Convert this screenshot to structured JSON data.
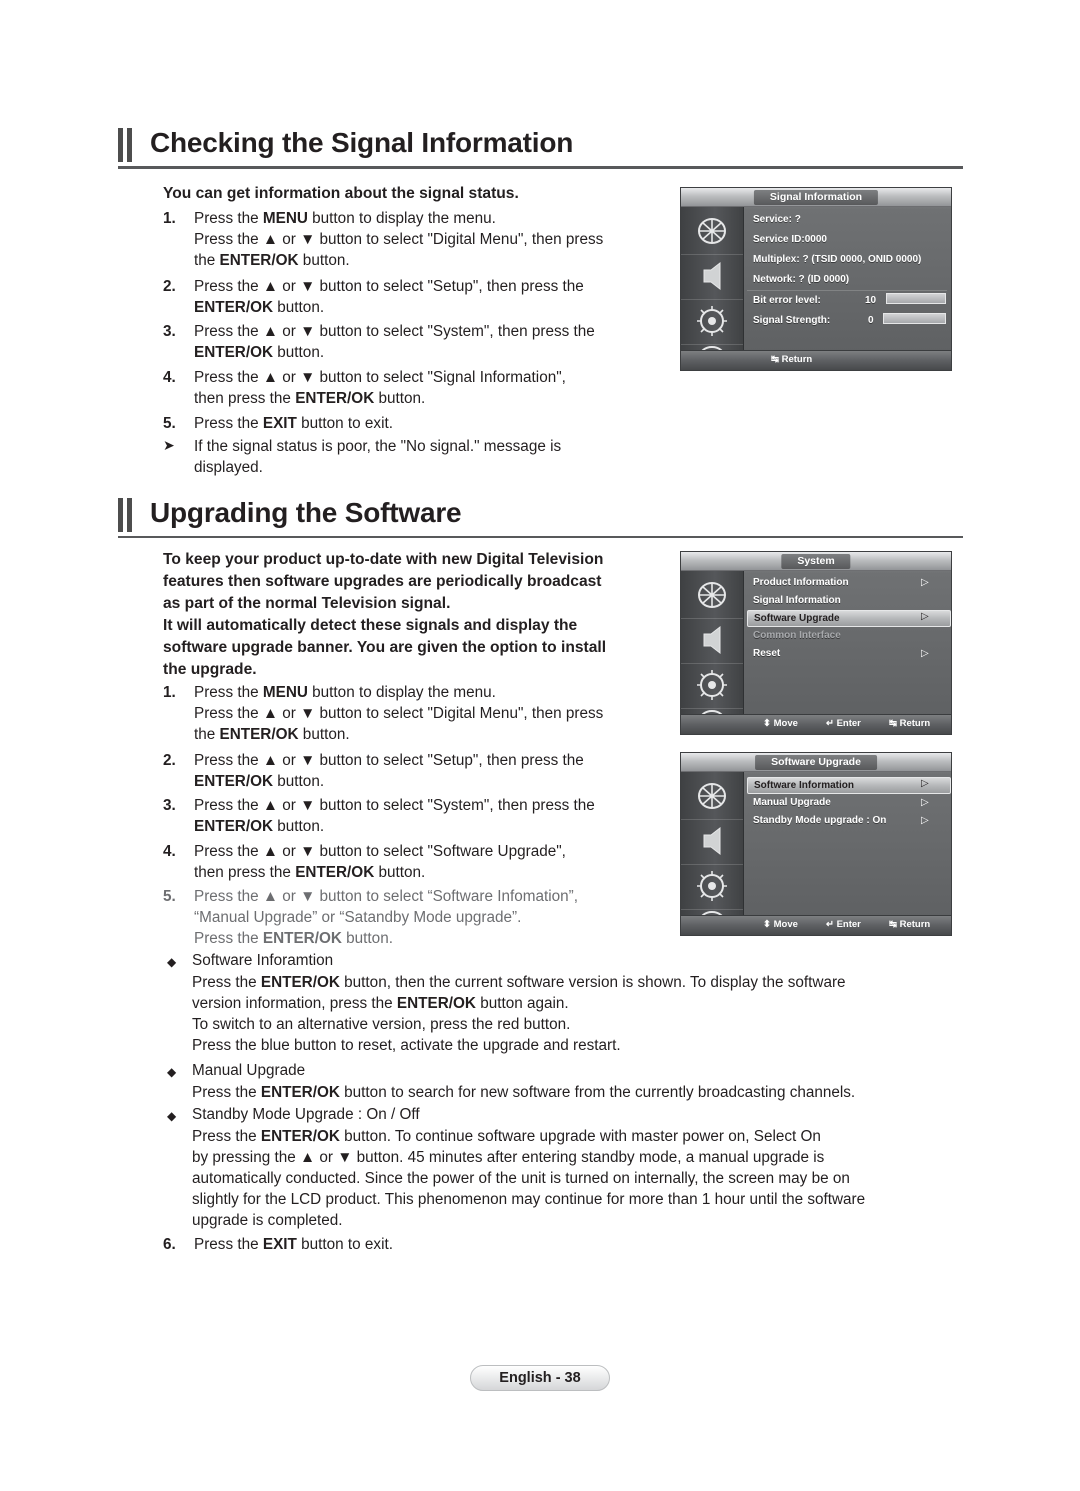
{
  "sections": {
    "signal": {
      "title": "Checking the Signal Information",
      "intro": "You can get information about the signal status.",
      "steps": [
        {
          "n": "1.",
          "lines": [
            "Press the MENU button to display the menu.",
            "Press the ▲ or ▼ button to select \"Digital Menu\", then press",
            "the ENTER/OK button."
          ]
        },
        {
          "n": "2.",
          "lines": [
            "Press the ▲ or ▼ button to select \"Setup\", then press the",
            "ENTER/OK button."
          ]
        },
        {
          "n": "3.",
          "lines": [
            "Press the ▲ or ▼ button to select \"System\", then press the",
            "ENTER/OK button."
          ]
        },
        {
          "n": "4.",
          "lines": [
            "Press the ▲ or ▼ button to select \"Signal Information\",",
            "then press the ENTER/OK button."
          ]
        },
        {
          "n": "5.",
          "lines": [
            "Press the EXIT button to exit."
          ]
        }
      ],
      "note": [
        "If the signal status is poor, the \"No signal.\" message is",
        "displayed."
      ]
    },
    "upgrade": {
      "title": "Upgrading the Software",
      "intro": [
        "To keep your product up-to-date with new Digital Television",
        "features then software upgrades are periodically broadcast",
        "as part of the normal Television signal.",
        "It will automatically detect these signals and display the",
        "software upgrade banner. You are given the option to install",
        "the upgrade."
      ],
      "steps": [
        {
          "n": "1.",
          "lines": [
            "Press the MENU button to display the menu.",
            "Press the ▲ or ▼ button to select \"Digital Menu\", then press",
            "the ENTER/OK button."
          ]
        },
        {
          "n": "2.",
          "lines": [
            "Press the ▲ or ▼ button to select \"Setup\", then press the",
            "ENTER/OK button."
          ]
        },
        {
          "n": "3.",
          "lines": [
            "Press the ▲ or ▼ button to select \"System\", then press the",
            "ENTER/OK button."
          ]
        },
        {
          "n": "4.",
          "lines": [
            "Press the ▲ or ▼ button to select \"Software Upgrade\",",
            "then press the ENTER/OK button."
          ]
        },
        {
          "n": "5.",
          "lines": [
            "Press the ▲ or ▼ button to select “Software Infomation”,",
            "“Manual Upgrade” or “Satandby Mode upgrade”.",
            "Press the ENTER/OK button."
          ]
        }
      ],
      "bullets": [
        {
          "title": "Software Inforamtion",
          "lines": [
            "Press the ENTER/OK button, then the current software version is shown. To display the software",
            "version information, press the ENTER/OK button again.",
            "To switch to an alternative version, press the red button.",
            "Press the blue button to reset, activate the upgrade and restart."
          ]
        },
        {
          "title": "Manual Upgrade",
          "lines": [
            "Press the ENTER/OK button to search for new software from the currently broadcasting channels."
          ]
        },
        {
          "title": "Standby Mode Upgrade : On / Off",
          "lines": [
            "Press the ENTER/OK button. To continue software upgrade with master power on, Select On",
            "by pressing the ▲ or ▼ button. 45 minutes after entering standby mode, a manual upgrade is",
            "automatically conducted. Since the power of the unit is turned on internally, the screen may be on",
            "slightly for the LCD product. This phenomenon may continue for more than 1 hour until the software",
            "upgrade is completed."
          ]
        }
      ],
      "last_step": {
        "n": "6.",
        "lines": [
          "Press the EXIT button to exit."
        ]
      }
    }
  },
  "osd": {
    "signal_information": {
      "title": "Signal Information",
      "rows": [
        "Service: ?",
        "Service ID:0000",
        "Multiplex: ? (TSID 0000, ONID 0000)",
        "Network: ? (ID 0000)"
      ],
      "bit_error": {
        "label": "Bit error level:",
        "value": "10"
      },
      "signal_strength": {
        "label": "Signal Strength:",
        "value": "0"
      },
      "footer": {
        "return": "↹ Return"
      }
    },
    "system": {
      "title": "System",
      "items": [
        {
          "label": "Product Information",
          "arrow": "▷",
          "selected": false
        },
        {
          "label": "Signal Information",
          "arrow": "",
          "selected": false
        },
        {
          "label": "Software Upgrade",
          "arrow": "▷",
          "selected": true
        },
        {
          "label": "Common Interface",
          "arrow": "",
          "selected": false,
          "dim": true
        },
        {
          "label": "Reset",
          "arrow": "▷",
          "selected": false
        }
      ],
      "footer": {
        "move": "⬍ Move",
        "enter": "↵ Enter",
        "return": "↹ Return"
      }
    },
    "software_upgrade": {
      "title": "Software Upgrade",
      "items": [
        {
          "label": "Software Information",
          "arrow": "▷",
          "selected": true
        },
        {
          "label": "Manual Upgrade",
          "arrow": "▷",
          "selected": false
        },
        {
          "label": "Standby Mode upgrade : On",
          "arrow": "▷",
          "selected": false
        }
      ],
      "footer": {
        "move": "⬍ Move",
        "enter": "↵ Enter",
        "return": "↹ Return"
      }
    }
  },
  "footer": {
    "page_label": "English - 38"
  }
}
